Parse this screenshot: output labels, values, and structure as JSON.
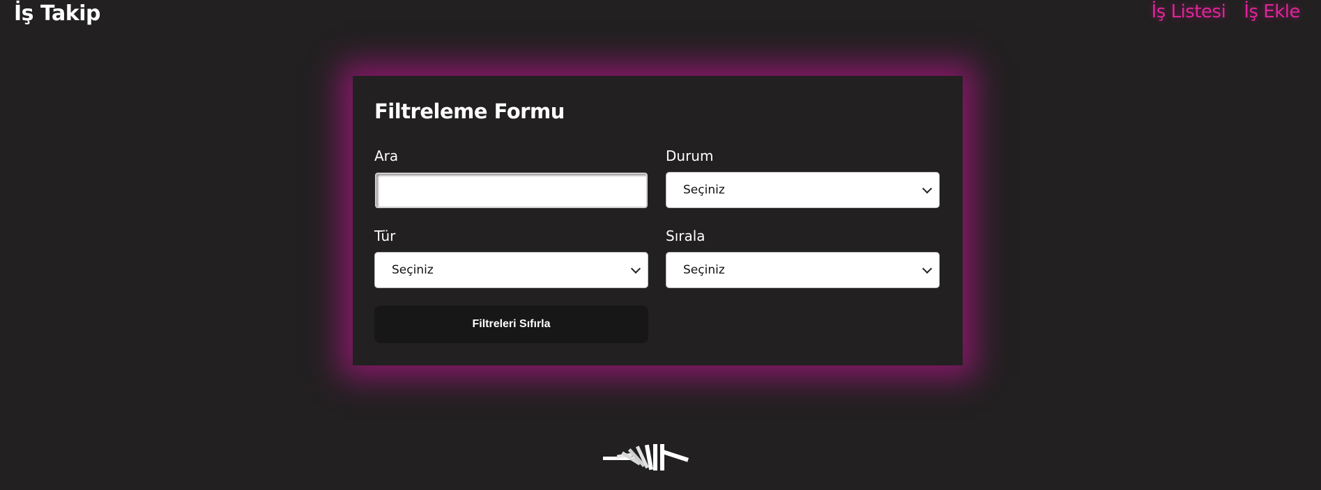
{
  "header": {
    "brand": "İş Takip",
    "nav": [
      {
        "label": "İş Listesi"
      },
      {
        "label": "İş Ekle"
      }
    ]
  },
  "form": {
    "title": "Filtreleme Formu",
    "search": {
      "label": "Ara",
      "value": "",
      "placeholder": ""
    },
    "status": {
      "label": "Durum",
      "selected": "Seçiniz"
    },
    "type": {
      "label": "Tür",
      "selected": "Seçiniz"
    },
    "sort": {
      "label": "Sırala",
      "selected": "Seçiniz"
    },
    "reset_label": "Filtreleri Sıfırla"
  },
  "colors": {
    "background": "#222021",
    "accent": "#e0249a",
    "glow": "#961873",
    "button": "#171717"
  },
  "icons": {
    "loader": "dominoes-loader-icon",
    "dropdown": "chevron-down-icon"
  }
}
